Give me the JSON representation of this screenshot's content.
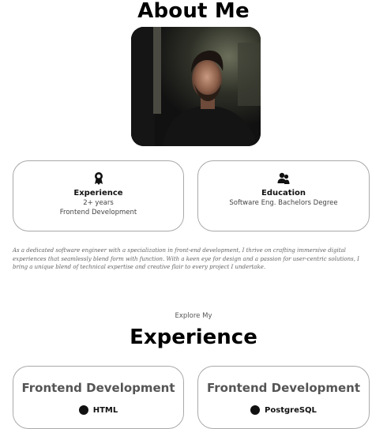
{
  "about": {
    "title": "About Me",
    "portrait_alt": "Portrait photo"
  },
  "cards": {
    "experience": {
      "icon": "award-icon",
      "title": "Experience",
      "line1": "2+ years",
      "line2": "Frontend Development"
    },
    "education": {
      "icon": "users-icon",
      "title": "Education",
      "line1": "Software Eng. Bachelors Degree"
    }
  },
  "bio": "As a dedicated software engineer with a specialization in front-end development, I thrive on crafting immersive digital experiences that seamlessly blend form with function. With a keen eye for design and a passion for user-centric solutions, I bring a unique blend of technical expertise and creative flair to every project I undertake.",
  "experience_section": {
    "kicker": "Explore My",
    "title": "Experience",
    "cards": [
      {
        "title": "Frontend Development",
        "first_skill": "HTML",
        "skill_icon": "check-circle-icon"
      },
      {
        "title": "Frontend Development",
        "first_skill": "PostgreSQL",
        "skill_icon": "check-circle-icon"
      }
    ]
  },
  "colors": {
    "text": "#111111",
    "muted": "#555555",
    "border": "#a9a9a9",
    "background": "#ffffff"
  }
}
